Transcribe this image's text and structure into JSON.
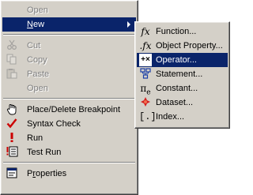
{
  "main_menu": {
    "open_top": "Open",
    "new_label": "New",
    "cut": "Cut",
    "copy": "Copy",
    "paste": "Paste",
    "open_bottom": "Open",
    "breakpoint": "Place/Delete Breakpoint",
    "syntax_check": "Syntax Check",
    "run": "Run",
    "test_run": "Test Run",
    "properties": "Properties"
  },
  "sub_menu": {
    "function": "Function...",
    "object_property": "Object Property...",
    "operator": "Operator...",
    "statement": "Statement...",
    "constant": "Constant...",
    "dataset": "Dataset...",
    "index": "Index..."
  },
  "colors": {
    "menu_bg": "#d4d0c8",
    "highlight": "#0a246a",
    "disabled_text": "#808080",
    "check_red": "#cc0000"
  },
  "icons": {
    "cut": "scissors-icon",
    "copy": "copy-icon",
    "paste": "paste-icon",
    "breakpoint": "hand-icon",
    "syntax_check": "checkmark-icon",
    "run": "exclamation-icon",
    "test_run": "test-run-icon",
    "properties": "properties-icon"
  }
}
